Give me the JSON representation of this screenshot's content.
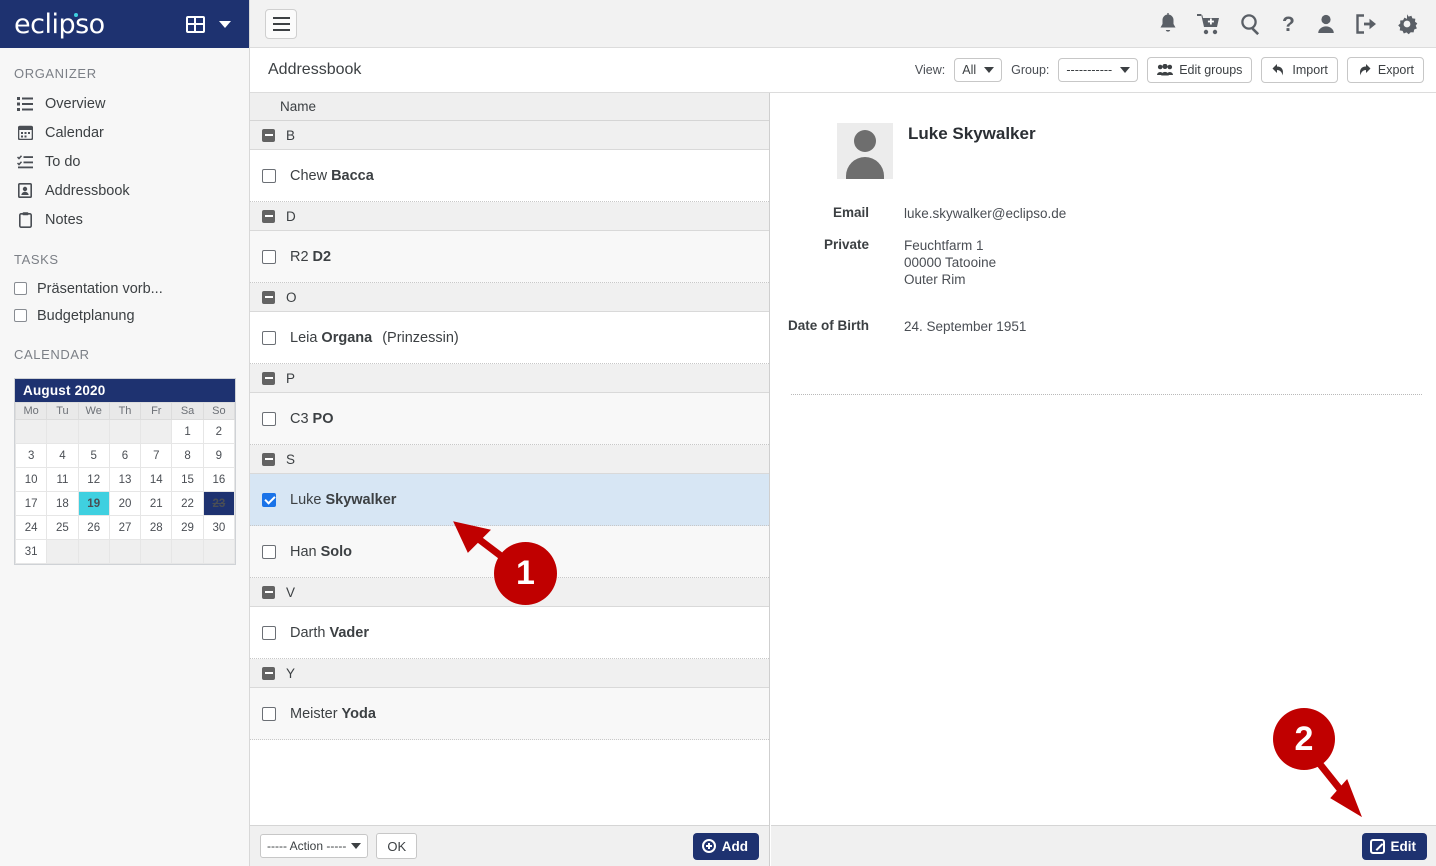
{
  "brand": {
    "logo_text": "eclipso",
    "grid_icon": "apps-grid-icon",
    "chevron_icon": "chevron-down-icon"
  },
  "sidebar": {
    "sections": [
      {
        "title": "ORGANIZER",
        "items": [
          {
            "label": "Overview",
            "icon": "list-icon"
          },
          {
            "label": "Calendar",
            "icon": "calendar-icon"
          },
          {
            "label": "To do",
            "icon": "tasks-icon"
          },
          {
            "label": "Addressbook",
            "icon": "contact-card-icon"
          },
          {
            "label": "Notes",
            "icon": "clipboard-icon"
          }
        ]
      }
    ],
    "tasks_title": "TASKS",
    "tasks": [
      {
        "label": "Präsentation vorb...",
        "checked": false
      },
      {
        "label": "Budgetplanung",
        "checked": false
      }
    ],
    "calendar_title": "CALENDAR",
    "calendar": {
      "month_label": "August 2020",
      "weekdays": [
        "Mo",
        "Tu",
        "We",
        "Th",
        "Fr",
        "Sa",
        "So"
      ],
      "weeks": [
        [
          "",
          "",
          "",
          "",
          "",
          "1",
          "2"
        ],
        [
          "3",
          "4",
          "5",
          "6",
          "7",
          "8",
          "9"
        ],
        [
          "10",
          "11",
          "12",
          "13",
          "14",
          "15",
          "16"
        ],
        [
          "17",
          "18",
          "19",
          "20",
          "21",
          "22",
          "23"
        ],
        [
          "24",
          "25",
          "26",
          "27",
          "28",
          "29",
          "30"
        ],
        [
          "31",
          "",
          "",
          "",
          "",
          "",
          ""
        ]
      ],
      "today": "19",
      "selected": "23",
      "today_color": "#3fd0e0",
      "selected_color": "#1e3270"
    }
  },
  "topbar": {
    "menu_icon": "hamburger-menu-icon",
    "icons": [
      "bell-icon",
      "cart-plus-icon",
      "search-icon",
      "help-icon",
      "user-icon",
      "logout-icon",
      "gear-icon"
    ]
  },
  "subheader": {
    "title": "Addressbook",
    "view_label": "View:",
    "view_value": "All",
    "group_label": "Group:",
    "group_value": "-----------",
    "edit_groups_label": "Edit groups",
    "import_label": "Import",
    "export_label": "Export"
  },
  "list": {
    "column_header": "Name",
    "groups": [
      {
        "letter": "B",
        "contacts": [
          {
            "first": "Chew",
            "last": "Bacca",
            "extra": "",
            "selected": false
          }
        ]
      },
      {
        "letter": "D",
        "contacts": [
          {
            "first": "R2",
            "last": "D2",
            "extra": "",
            "selected": false
          }
        ]
      },
      {
        "letter": "O",
        "contacts": [
          {
            "first": "Leia",
            "last": "Organa",
            "extra": "(Prinzessin)",
            "selected": false
          }
        ]
      },
      {
        "letter": "P",
        "contacts": [
          {
            "first": "C3",
            "last": "PO",
            "extra": "",
            "selected": false
          }
        ]
      },
      {
        "letter": "S",
        "contacts": [
          {
            "first": "Luke",
            "last": "Skywalker",
            "extra": "",
            "selected": true
          },
          {
            "first": "Han",
            "last": "Solo",
            "extra": "",
            "selected": false
          }
        ]
      },
      {
        "letter": "V",
        "contacts": [
          {
            "first": "Darth",
            "last": "Vader",
            "extra": "",
            "selected": false
          }
        ]
      },
      {
        "letter": "Y",
        "contacts": [
          {
            "first": "Meister",
            "last": "Yoda",
            "extra": "",
            "selected": false
          }
        ]
      }
    ],
    "footer": {
      "action_label": "----- Action -----",
      "ok_label": "OK",
      "add_label": "Add"
    }
  },
  "detail": {
    "name": "Luke Skywalker",
    "avatar": "person-placeholder-avatar",
    "fields": [
      {
        "label": "Email",
        "value": "luke.skywalker@eclipso.de"
      },
      {
        "label": "Private",
        "value": "Feuchtfarm 1\n00000 Tatooine\nOuter Rim"
      }
    ],
    "dob_label": "Date of Birth",
    "dob_value": "24. September 1951",
    "edit_label": "Edit"
  },
  "annotations": [
    {
      "number": "1",
      "color": "#c00000"
    },
    {
      "number": "2",
      "color": "#c00000"
    }
  ]
}
